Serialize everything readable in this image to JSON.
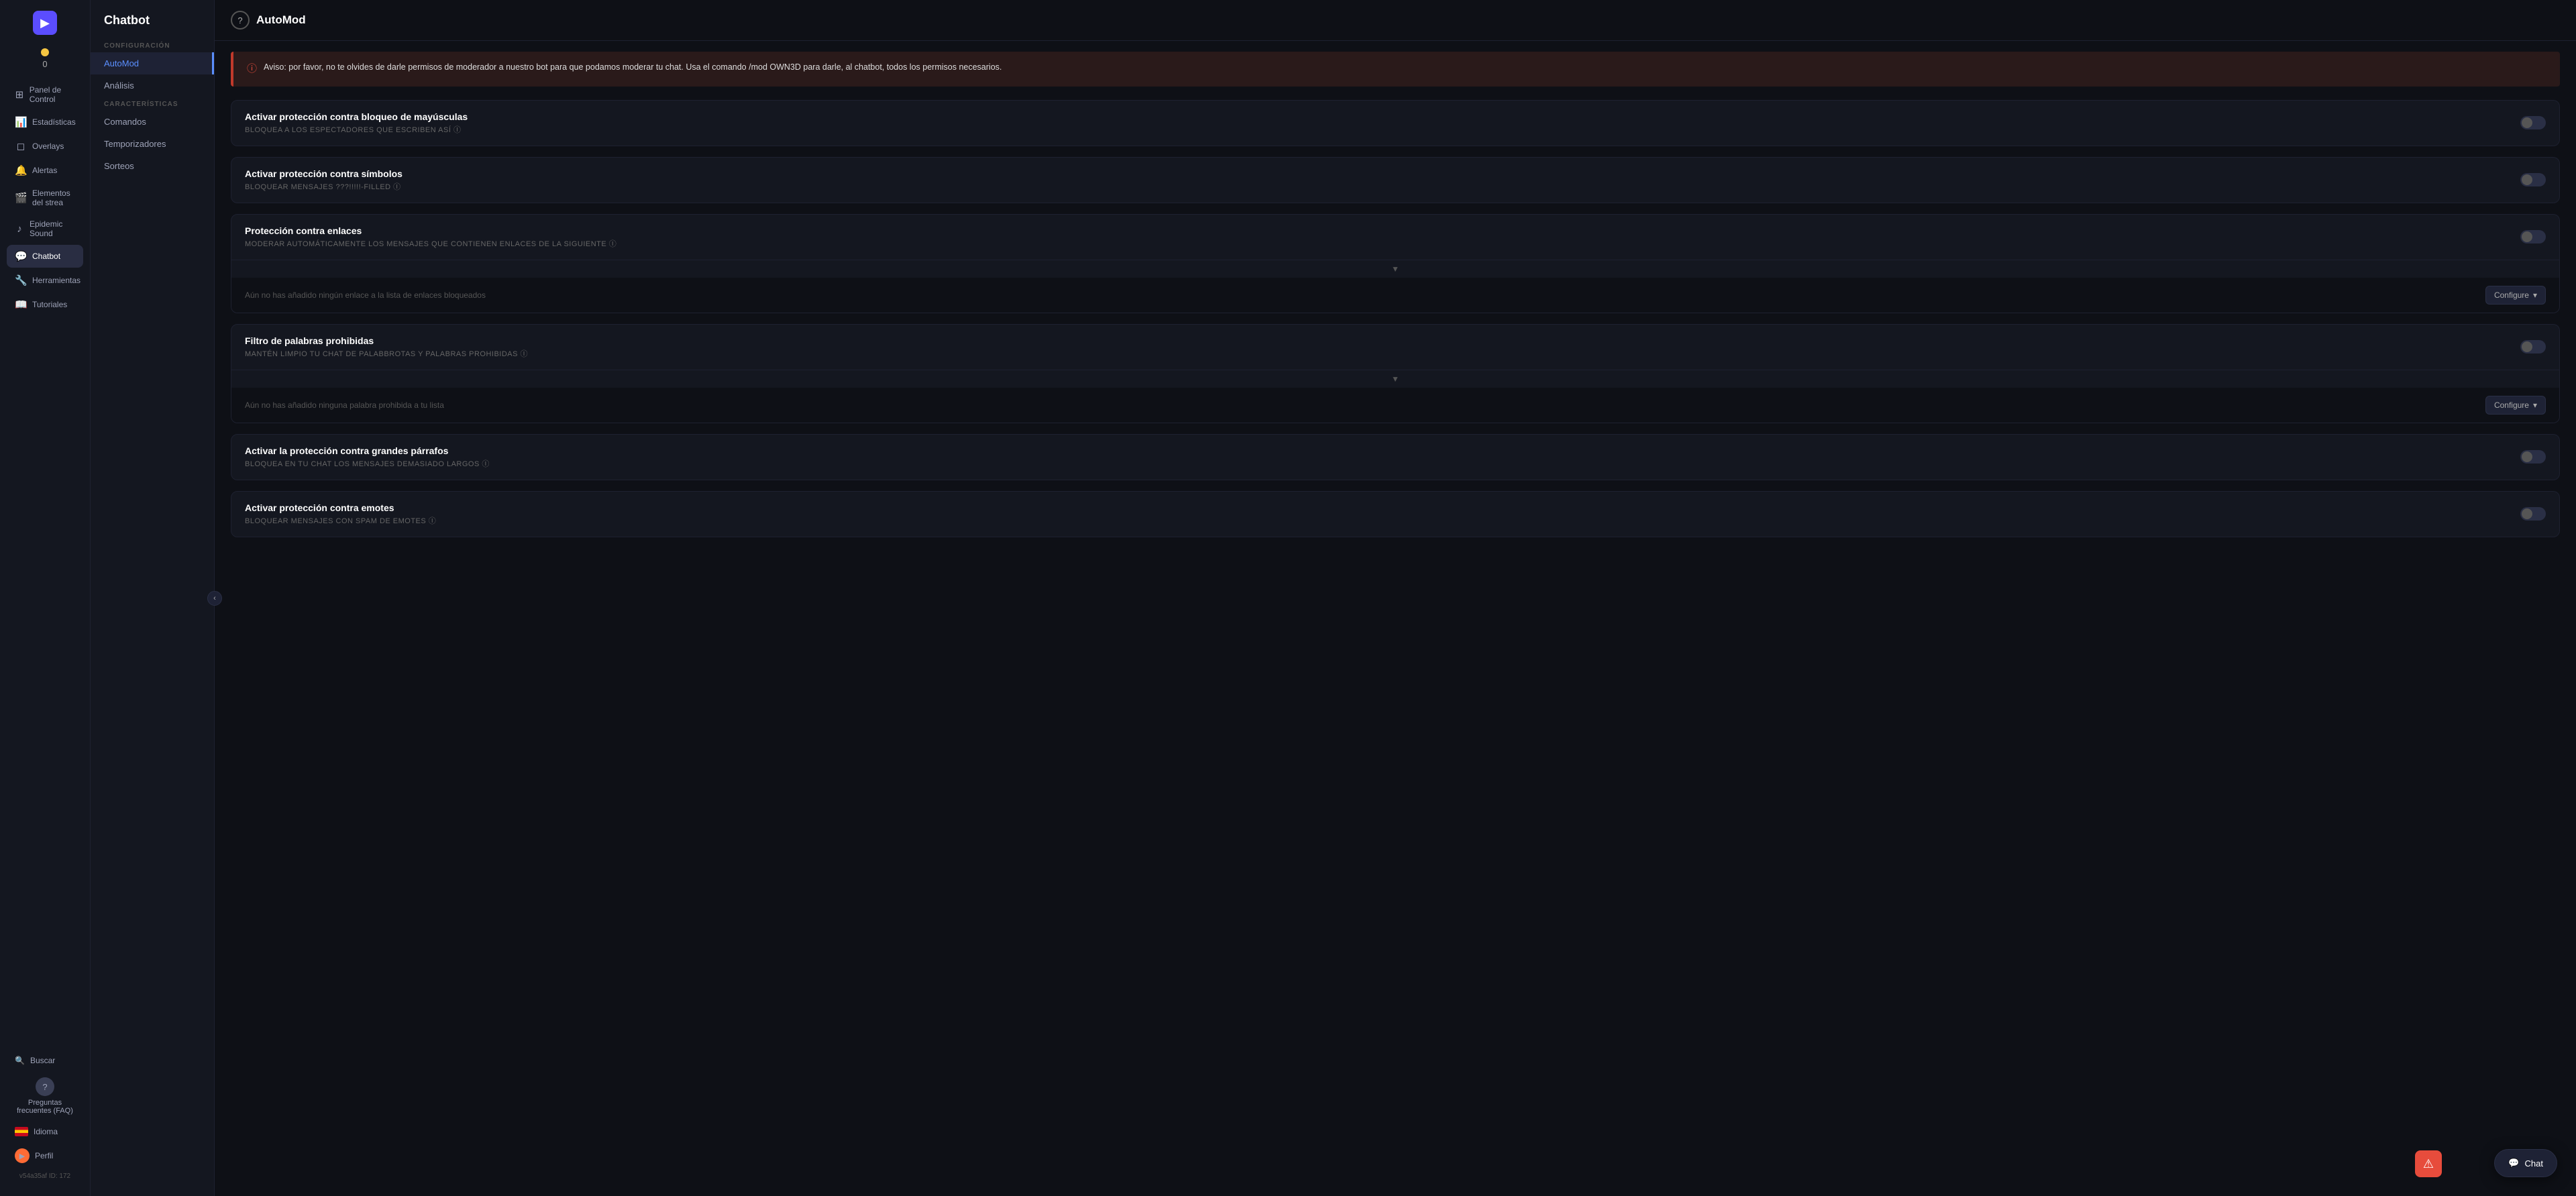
{
  "app": {
    "logo": "▶",
    "score": {
      "label": "0"
    }
  },
  "sidebar": {
    "items": [
      {
        "id": "panel",
        "icon": "⊞",
        "label": "Panel de Control"
      },
      {
        "id": "estadisticas",
        "icon": "📊",
        "label": "Estadísticas"
      },
      {
        "id": "overlays",
        "icon": "◻",
        "label": "Overlays"
      },
      {
        "id": "alertas",
        "icon": "🔔",
        "label": "Alertas"
      },
      {
        "id": "elementos",
        "icon": "🎬",
        "label": "Elementos del strea"
      },
      {
        "id": "epidemic",
        "icon": "♪",
        "label": "Epidemic Sound"
      },
      {
        "id": "chatbot",
        "icon": "💬",
        "label": "Chatbot"
      },
      {
        "id": "herramientas",
        "icon": "🔧",
        "label": "Herramientas"
      },
      {
        "id": "tutoriales",
        "icon": "📖",
        "label": "Tutoriales"
      }
    ],
    "search": {
      "icon": "🔍",
      "label": "Buscar"
    },
    "faq": {
      "icon": "?",
      "label": "Preguntas frecuentes (FAQ)"
    },
    "idioma": {
      "label": "Idioma"
    },
    "perfil": {
      "icon": "▶",
      "label": "Perfil"
    },
    "user_id": "v54a35af\nID: 172"
  },
  "sub_sidebar": {
    "title": "Chatbot",
    "sections": [
      {
        "label": "CONFIGURACIÓN",
        "items": [
          {
            "id": "automod",
            "label": "AutoMod",
            "active": true
          },
          {
            "id": "analisis",
            "label": "Análisis"
          }
        ]
      },
      {
        "label": "CARACTERÍSTICAS",
        "items": [
          {
            "id": "comandos",
            "label": "Comandos"
          },
          {
            "id": "temporizadores",
            "label": "Temporizadores"
          },
          {
            "id": "sorteos",
            "label": "Sorteos"
          }
        ]
      }
    ]
  },
  "topbar": {
    "icon": "?",
    "title": "AutoMod"
  },
  "alert_banner": {
    "text": "Aviso: por favor, no te olvides de darle permisos de moderador a nuestro bot para que podamos moderar tu chat. Usa el comando /mod OWN3D para darle, al chatbot, todos los permisos necesarios."
  },
  "cards": [
    {
      "id": "mayusculas",
      "title": "Activar protección contra bloqueo de mayúsculas",
      "subtitle": "BLOQUEA A LOS ESPECTADORES QUE ESCRIBEN ASÍ ⓘ",
      "toggle": false
    },
    {
      "id": "simbolos",
      "title": "Activar protección contra símbolos",
      "subtitle": "Bloquear mensajes ???!!!!!-filled ⓘ",
      "toggle": false
    },
    {
      "id": "enlaces",
      "title": "Protección contra enlaces",
      "subtitle": "Moderar automáticamente los mensajes que contienen enlaces de la siguiente ⓘ",
      "toggle": false,
      "has_config": true,
      "config_placeholder": "Aún no has añadido ningún enlace a la lista de enlaces bloqueados",
      "configure_label": "Configure"
    },
    {
      "id": "palabras",
      "title": "Filtro de palabras prohibidas",
      "subtitle": "Mantén limpio tu chat de palabbrotas y palabras prohibidas ⓘ",
      "toggle": false,
      "has_config": true,
      "config_placeholder": "Aún no has añadido ninguna palabra prohibida a tu lista",
      "configure_label": "Configure"
    },
    {
      "id": "parrafos",
      "title": "Activar la protección contra grandes párrafos",
      "subtitle": "Bloquea en tu chat los mensajes demasiado largos ⓘ",
      "toggle": false
    },
    {
      "id": "emotes",
      "title": "Activar protección contra emotes",
      "subtitle": "Bloquear mensajes con spam de emotes ⓘ",
      "toggle": false
    }
  ],
  "chat_fab": {
    "icon": "💬",
    "label": "Chat"
  },
  "alert_corner": {
    "icon": "⚠"
  }
}
